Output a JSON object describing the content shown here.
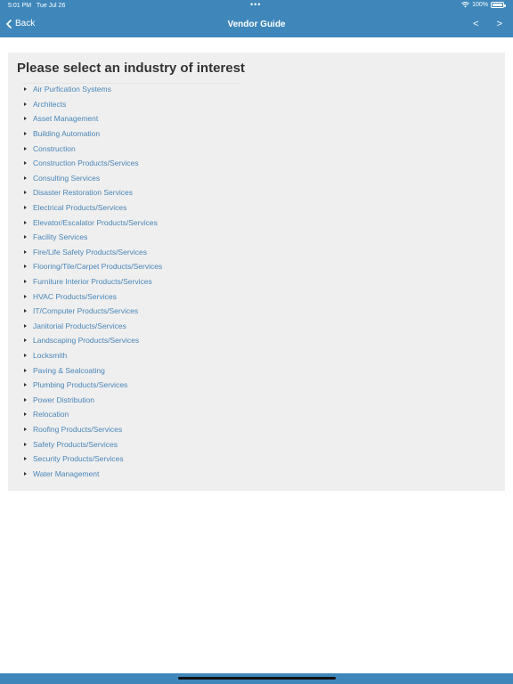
{
  "status_bar": {
    "time": "5:01 PM",
    "date": "Tue Jul 26",
    "battery": "100%"
  },
  "nav": {
    "back_label": "Back",
    "title": "Vendor Guide",
    "prev": "<",
    "next": ">"
  },
  "content": {
    "heading": "Please select an industry of interest",
    "industries": [
      "Air Purfication Systems",
      "Architects",
      "Asset Management",
      "Building Automation",
      "Construction",
      "Construction Products/Services",
      "Consulting Services",
      "Disaster Restoration Services",
      "Electrical Products/Services",
      "Elevator/Escalator Products/Services",
      "Facility Services",
      "Fire/Life Safety Products/Services",
      "Flooring/Tile/Carpet Products/Services",
      "Furniture Interior Products/Services",
      "HVAC Products/Services",
      "IT/Computer Products/Services",
      "Janitorial Products/Services",
      "Landscaping Products/Services",
      "Locksmith",
      "Paving & Sealcoating",
      "Plumbing Products/Services",
      "Power Distribution",
      "Relocation",
      "Roofing Products/Services",
      "Safety Products/Services",
      "Security Products/Services",
      "Water Management"
    ]
  },
  "colors": {
    "accent": "#3f87bb",
    "link": "#4a86b8",
    "panel": "#efefef"
  }
}
